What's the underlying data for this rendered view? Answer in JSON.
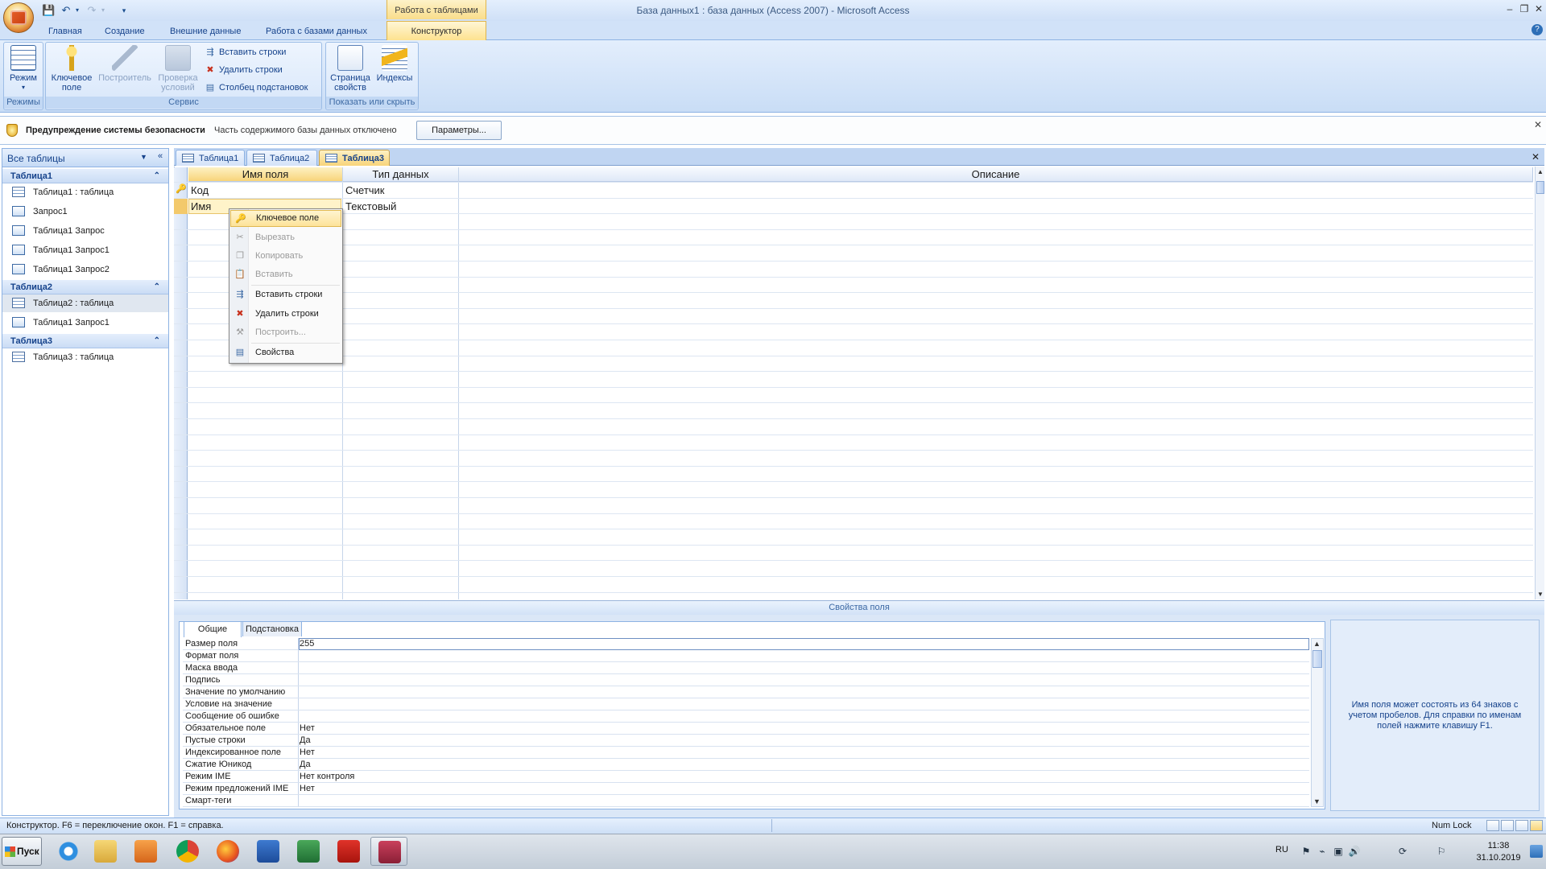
{
  "window": {
    "title": "База данных1 : база данных (Access 2007) - Microsoft Access",
    "context_tab_group": "Работа с таблицами",
    "min": "–",
    "max": "❐",
    "close": "✕"
  },
  "ribbon_tabs": [
    "Главная",
    "Создание",
    "Внешние данные",
    "Работа с базами данных",
    "Конструктор"
  ],
  "ribbon": {
    "groups": {
      "modes": "Режимы",
      "service": "Сервис",
      "show_hide": "Показать или скрыть"
    },
    "mode_btn": "Режим",
    "key_field_1": "Ключевое",
    "key_field_2": "поле",
    "builder": "Построитель",
    "check_1": "Проверка",
    "check_2": "условий",
    "insert_rows": "Вставить строки",
    "delete_rows": "Удалить строки",
    "lookup_col": "Столбец  подстановок",
    "prop_sheet_1": "Страница",
    "prop_sheet_2": "свойств",
    "indexes": "Индексы"
  },
  "security": {
    "title": "Предупреждение системы безопасности",
    "message": "Часть содержимого базы данных отключено",
    "params_btn": "Параметры..."
  },
  "nav": {
    "title": "Все таблицы",
    "groups": [
      {
        "name": "Таблица1",
        "items": [
          "Таблица1 : таблица",
          "Запрос1",
          "Таблица1 Запрос",
          "Таблица1 Запрос1",
          "Таблица1 Запрос2"
        ]
      },
      {
        "name": "Таблица2",
        "items": [
          "Таблица2 : таблица",
          "Таблица1 Запрос1"
        ]
      },
      {
        "name": "Таблица3",
        "items": [
          "Таблица3 : таблица"
        ]
      }
    ]
  },
  "doc_tabs": [
    "Таблица1",
    "Таблица2",
    "Таблица3"
  ],
  "grid": {
    "headers": [
      "Имя поля",
      "Тип данных",
      "Описание"
    ],
    "rows": [
      {
        "name": "Код",
        "type": "Счетчик"
      },
      {
        "name": "Имя",
        "type": "Текстовый"
      }
    ]
  },
  "context_menu": {
    "items": [
      "Ключевое поле",
      "Вырезать",
      "Копировать",
      "Вставить",
      "Вставить строки",
      "Удалить строки",
      "Построить...",
      "Свойства"
    ],
    "disabled": [
      false,
      true,
      true,
      true,
      false,
      false,
      true,
      false
    ]
  },
  "props": {
    "title": "Свойства поля",
    "tabs": [
      "Общие",
      "Подстановка"
    ],
    "rows": [
      {
        "label": "Размер поля",
        "value": "255"
      },
      {
        "label": "Формат поля",
        "value": ""
      },
      {
        "label": "Маска ввода",
        "value": ""
      },
      {
        "label": "Подпись",
        "value": ""
      },
      {
        "label": "Значение по умолчанию",
        "value": ""
      },
      {
        "label": "Условие на значение",
        "value": ""
      },
      {
        "label": "Сообщение об ошибке",
        "value": ""
      },
      {
        "label": "Обязательное поле",
        "value": "Нет"
      },
      {
        "label": "Пустые строки",
        "value": "Да"
      },
      {
        "label": "Индексированное поле",
        "value": "Нет"
      },
      {
        "label": "Сжатие Юникод",
        "value": "Да"
      },
      {
        "label": "Режим IME",
        "value": "Нет контроля"
      },
      {
        "label": "Режим предложений IME",
        "value": "Нет"
      },
      {
        "label": "Смарт-теги",
        "value": ""
      }
    ],
    "help": "Имя поля может состоять из 64 знаков с учетом пробелов. Для справки по именам полей нажмите клавишу F1."
  },
  "status": {
    "text": "Конструктор.  F6 = переключение окон.  F1 = справка.",
    "numlock": "Num Lock"
  },
  "taskbar": {
    "start": "Пуск",
    "lang": "RU",
    "time": "11:38",
    "date": "31.10.2019"
  },
  "colors": {
    "accent": "#15428b",
    "context_tab": "#fde18c",
    "ribbon_bg": "#d1e2f8"
  }
}
